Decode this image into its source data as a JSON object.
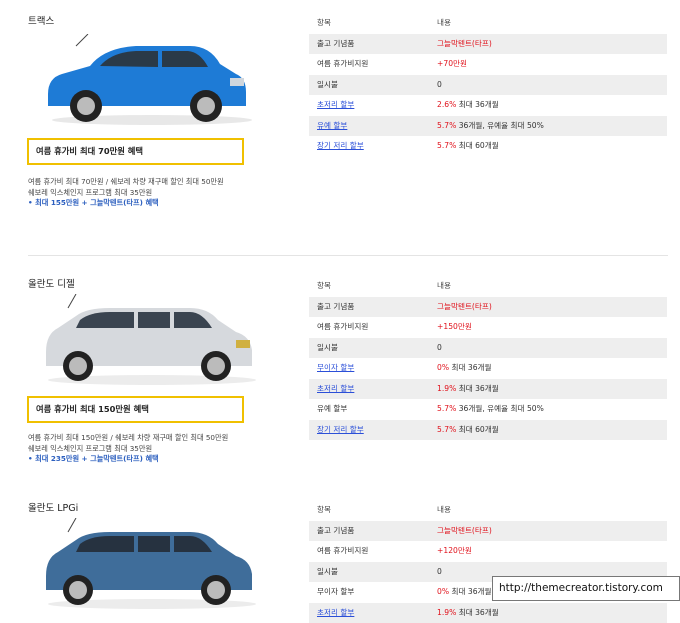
{
  "sections": [
    {
      "name": "트랙스",
      "promo": "여름 휴가비 최대 70만원 혜택",
      "notes": [
        "여름 휴가비 최대 70만원   /   쉐보레 차량 재구매 할인 최대 50만원",
        "쉐보레 익스체인지 프로그램 최대 35만원"
      ],
      "total": "• 최대 155만원 + 그늘막텐트(타프) 혜택",
      "body_color": "#1e7bd6",
      "rows": [
        {
          "label": "항목",
          "value": "내용"
        },
        {
          "label": "출고 기념품",
          "value": "그늘막텐트(타프)",
          "value_red": true
        },
        {
          "label": "여름 휴가비지원",
          "value": "+70만원",
          "value_red": true
        },
        {
          "label": "일시불",
          "value": "0"
        },
        {
          "label": "초저리 할부",
          "label_link": true,
          "rate": "2.6%",
          "value": "최대 36개월"
        },
        {
          "label": "유예 할부",
          "label_link": true,
          "rate": "5.7%",
          "value": "36개월, 유예율 최대 50%"
        },
        {
          "label": "장기 저리 할부",
          "label_link": true,
          "rate": "5.7%",
          "value": "최대 60개월"
        }
      ]
    },
    {
      "name": "올란도 디젤",
      "promo": "여름 휴가비 최대 150만원 혜택",
      "notes": [
        "여름 휴가비 최대 150만원   /   쉐보레 차량 재구매 할인 최대 50만원",
        "쉐보레 익스체인지 프로그램 최대 35만원"
      ],
      "total": "• 최대 235만원 + 그늘막텐트(타프) 혜택",
      "body_color": "#d6d9dd",
      "rows": [
        {
          "label": "항목",
          "value": "내용"
        },
        {
          "label": "출고 기념품",
          "value": "그늘막텐트(타프)",
          "value_red": true
        },
        {
          "label": "여름 휴가비지원",
          "value": "+150만원",
          "value_red": true
        },
        {
          "label": "일시불",
          "value": "0"
        },
        {
          "label": "무이자 할부",
          "label_link": true,
          "rate": "0%",
          "value": "최대 36개월"
        },
        {
          "label": "초저리 할부",
          "label_link": true,
          "rate": "1.9%",
          "value": "최대 36개월"
        },
        {
          "label": "유예 할부",
          "rate": "5.7%",
          "value": "36개월, 유예율 최대 50%"
        },
        {
          "label": "장기 저리 할부",
          "label_link": true,
          "rate": "5.7%",
          "value": "최대 60개월"
        }
      ]
    },
    {
      "name": "올란도 LPGi",
      "body_color": "#3f6d9a",
      "rows": [
        {
          "label": "항목",
          "value": "내용"
        },
        {
          "label": "출고 기념품",
          "value": "그늘막텐트(타프)",
          "value_red": true
        },
        {
          "label": "여름 휴가비지원",
          "value": "+120만원",
          "value_red": true
        },
        {
          "label": "일시불",
          "value": "0"
        },
        {
          "label": "무이자 할부",
          "rate": "0%",
          "value": "최대 36개월"
        },
        {
          "label": "초저리 할부",
          "label_link": true,
          "rate": "1.9%",
          "value": "최대 36개월"
        }
      ]
    }
  ],
  "watermark": "http://themecreator.tistory.com"
}
